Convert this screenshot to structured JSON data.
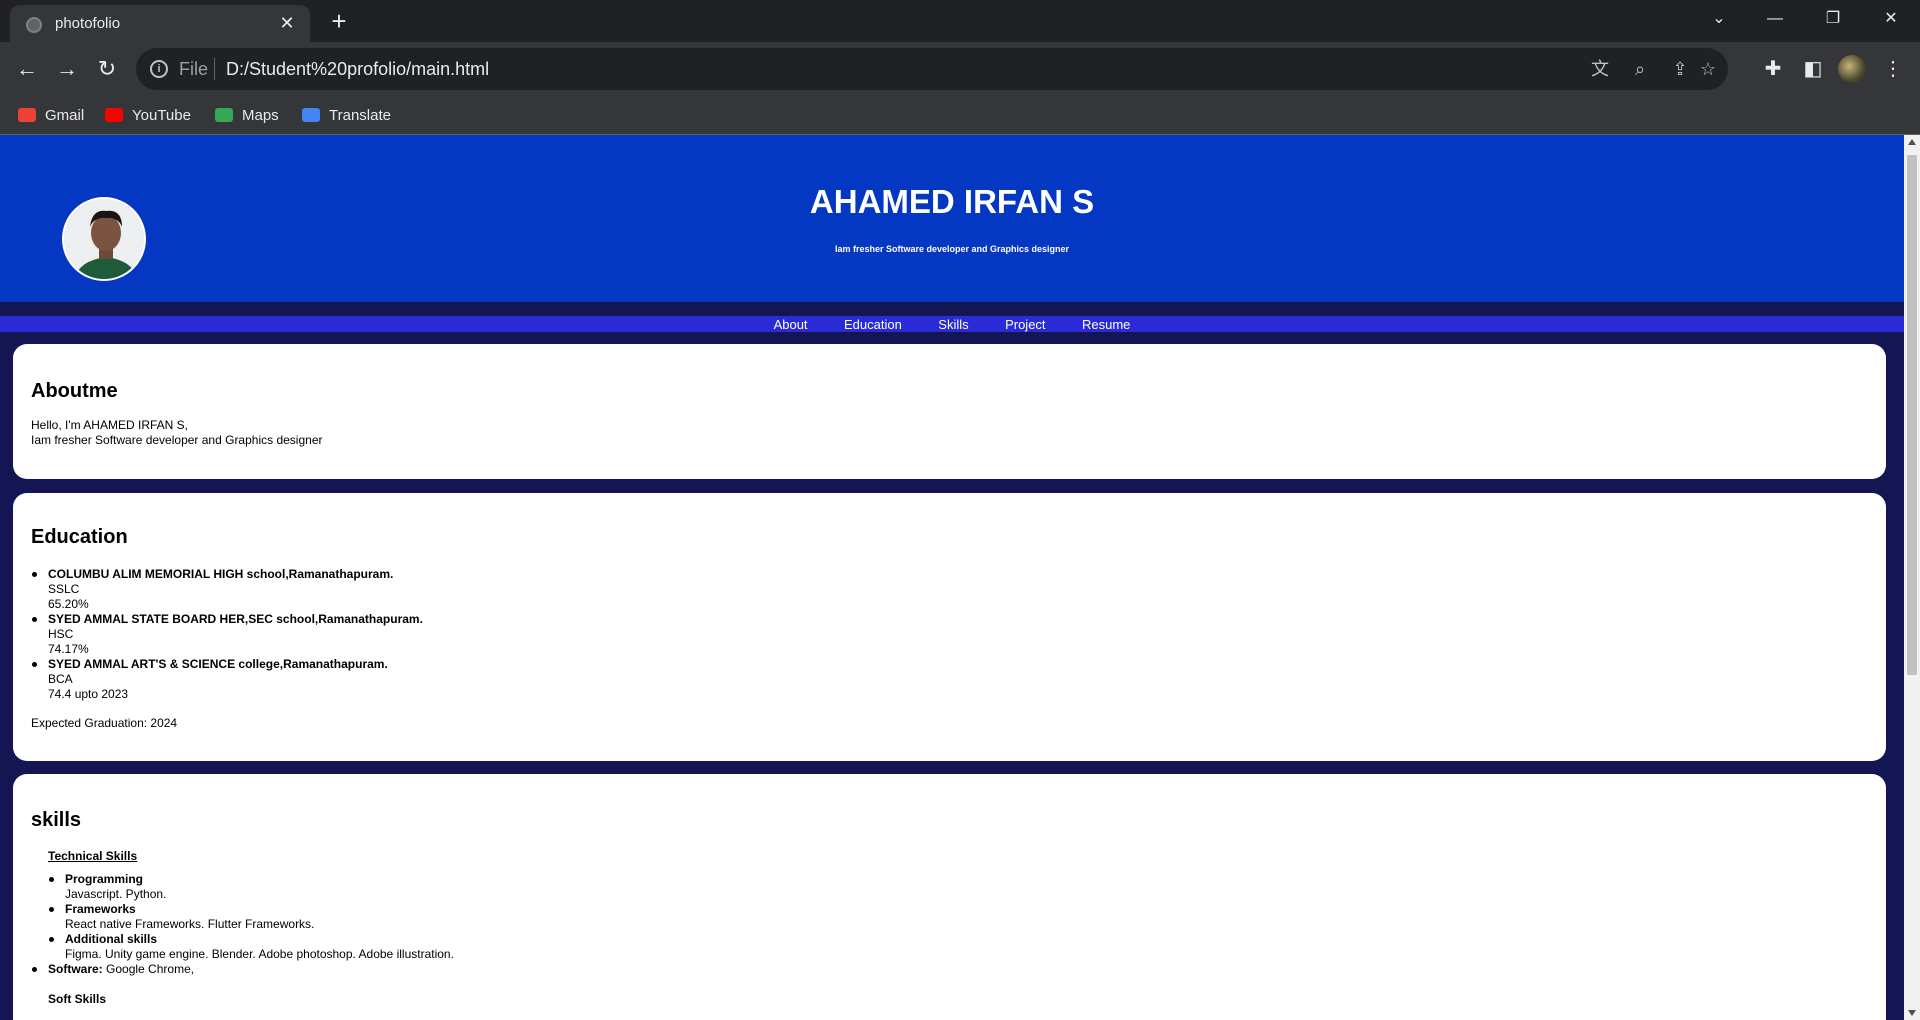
{
  "browser": {
    "tab_title": "photofolio",
    "url_scheme": "File",
    "url": "D:/Student%20profolio/main.html",
    "bookmarks": [
      {
        "label": "Gmail",
        "color": "#ea4335"
      },
      {
        "label": "YouTube",
        "color": "#ff0000"
      },
      {
        "label": "Maps",
        "color": "#34a853"
      },
      {
        "label": "Translate",
        "color": "#4285f4"
      }
    ]
  },
  "hero": {
    "name": "AHAMED IRFAN S",
    "tagline": "Iam fresher Software developer and Graphics designer"
  },
  "nav": [
    "About",
    "Education",
    "Skills",
    "Project",
    "Resume"
  ],
  "about": {
    "heading": "Aboutme",
    "line1": "Hello, I'm AHAMED IRFAN S,",
    "line2": "Iam fresher Software developer and Graphics designer"
  },
  "education": {
    "heading": "Education",
    "items": [
      {
        "school": "COLUMBU ALIM MEMORIAL HIGH school,Ramanathapuram.",
        "course": "SSLC",
        "score": "65.20%"
      },
      {
        "school": "SYED AMMAL STATE BOARD HER,SEC school,Ramanathapuram.",
        "course": "HSC",
        "score": "74.17%"
      },
      {
        "school": "SYED AMMAL ART'S & SCIENCE college,Ramanathapuram.",
        "course": "BCA",
        "score": "74.4 upto 2023"
      }
    ],
    "expected": "Expected Graduation: 2024"
  },
  "skills": {
    "heading": "skills",
    "technical_heading": "Technical Skills",
    "technical": [
      {
        "title": "Programming",
        "detail": "Javascript. Python."
      },
      {
        "title": "Frameworks",
        "detail": "React native Frameworks. Flutter Frameworks."
      },
      {
        "title": "Additional skills",
        "detail": "Figma. Unity game engine. Blender. Adobe photoshop. Adobe illustration."
      }
    ],
    "software_label": "Software:",
    "software_value": "Google Chrome,",
    "soft_heading": "Soft Skills"
  },
  "colors": {
    "hero_bg": "#0437c2",
    "page_bg": "#131653",
    "nav_bg": "#2a2ad6"
  }
}
